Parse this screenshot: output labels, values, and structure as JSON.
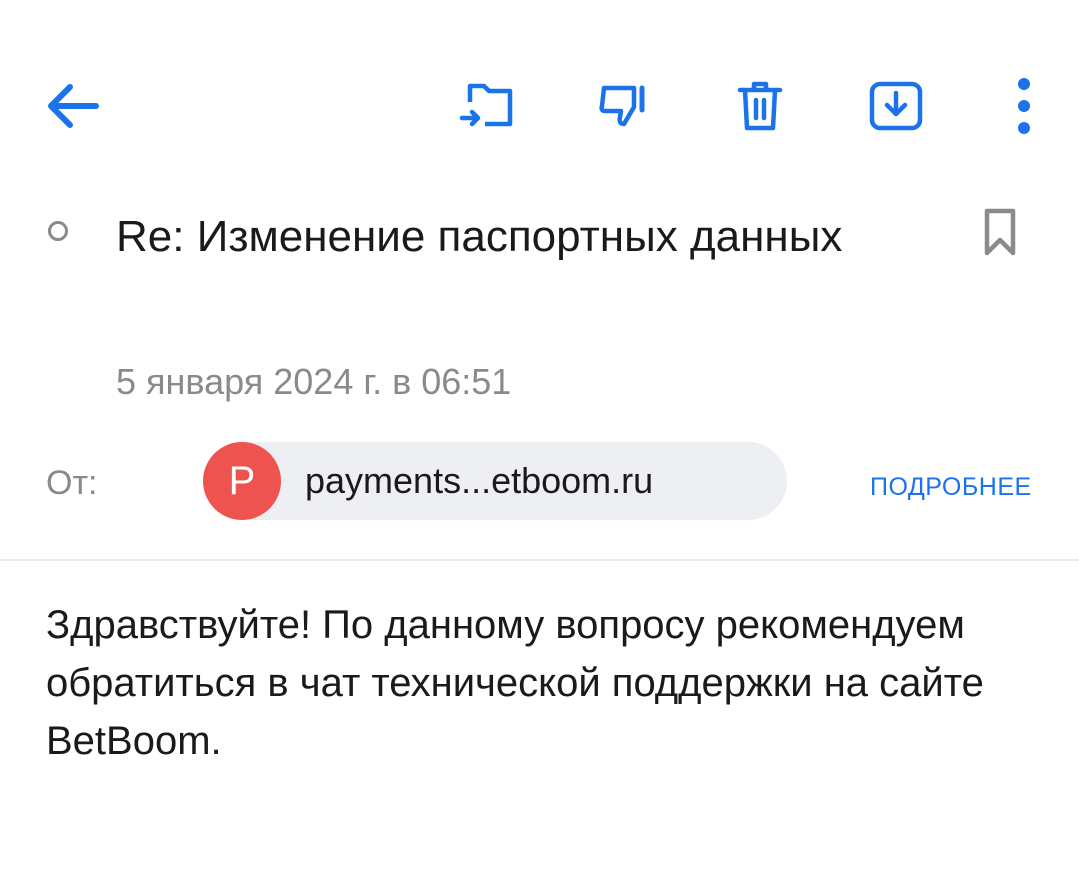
{
  "toolbar": {
    "back_icon": "arrow-left-icon",
    "move_icon": "folder-move-icon",
    "spam_icon": "thumb-down-icon",
    "delete_icon": "trash-icon",
    "archive_icon": "archive-download-icon",
    "more_icon": "more-vertical-icon",
    "accent_color": "#1a73e8"
  },
  "message": {
    "subject": "Re: Изменение паспортных данных",
    "date": "5 января 2024 г. в 06:51",
    "from_label": "От:",
    "sender": {
      "avatar_letter": "P",
      "avatar_color": "#ef5350",
      "email": "payments...etboom.ru"
    },
    "details_link": "ПОДРОБНЕЕ",
    "body": "Здравствуйте! По данному вопросу рекомендуем обратиться в чат технической поддержки на сайте BetBoom."
  }
}
